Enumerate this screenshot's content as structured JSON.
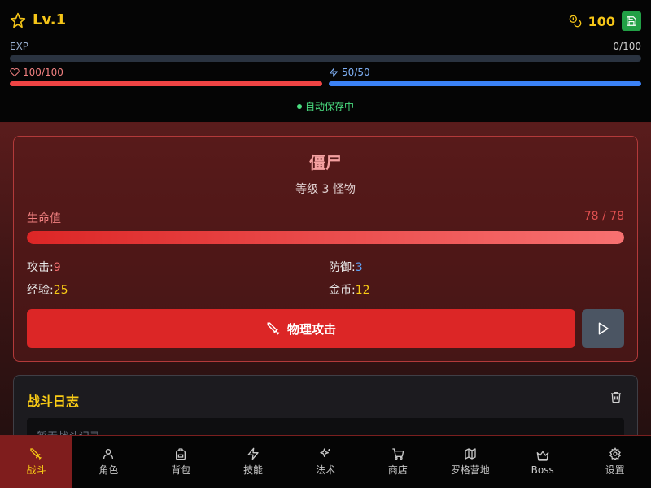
{
  "header": {
    "level": "Lv.1",
    "gold": "100",
    "exp_label": "EXP",
    "exp_value": "0/100",
    "exp_fraction": 0,
    "hp_text": "100/100",
    "hp_fraction": 1,
    "mp_text": "50/50",
    "mp_fraction": 1,
    "autosave": "自动保存中"
  },
  "monster": {
    "name": "僵尸",
    "subtitle": "等级 3 怪物",
    "hp_label": "生命值",
    "hp_value": "78 / 78",
    "hp_fraction": 1,
    "attack_label": "攻击:",
    "attack_value": "9",
    "defense_label": "防御:",
    "defense_value": "3",
    "exp_label": "经验:",
    "exp_value": "25",
    "gold_label": "金币:",
    "gold_value": "12",
    "attack_button": "物理攻击"
  },
  "log": {
    "title": "战斗日志",
    "empty_text": "暂无战斗记录"
  },
  "nav": {
    "items": [
      {
        "label": "战斗",
        "icon": "sword-icon",
        "active": true
      },
      {
        "label": "角色",
        "icon": "user-icon"
      },
      {
        "label": "背包",
        "icon": "backpack-icon"
      },
      {
        "label": "技能",
        "icon": "lightning-icon"
      },
      {
        "label": "法术",
        "icon": "sparkles-icon"
      },
      {
        "label": "商店",
        "icon": "cart-icon"
      },
      {
        "label": "罗格营地",
        "icon": "map-icon"
      },
      {
        "label": "Boss",
        "icon": "crown-icon"
      },
      {
        "label": "设置",
        "icon": "gear-icon"
      }
    ]
  },
  "colors": {
    "accent_gold": "#f5c518",
    "hp_red": "#ef4444",
    "mp_blue": "#3b82f6",
    "save_green": "#22a046"
  }
}
